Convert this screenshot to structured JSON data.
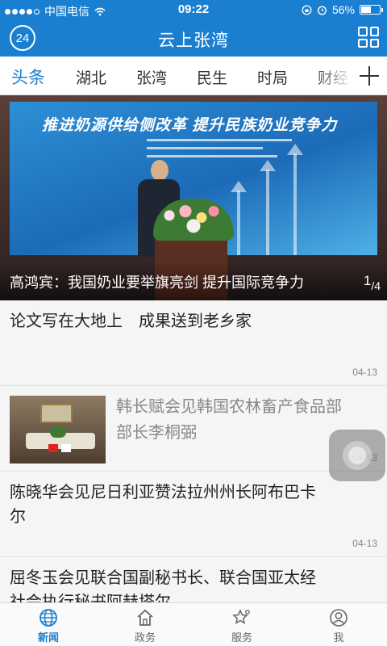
{
  "status_bar": {
    "carrier": "中国电信",
    "time": "09:22",
    "battery": "56%",
    "battery_level": 0.56
  },
  "app_bar": {
    "title": "云上张湾",
    "logo_text": "24"
  },
  "tabs": [
    "头条",
    "湖北",
    "张湾",
    "民生",
    "时局",
    "财经"
  ],
  "hero": {
    "banner": "推进奶源供给侧改革 提升民族奶业竞争力",
    "caption": "高鸿宾：我国奶业要举旗亮剑 提升国际竞争力",
    "pager_current": "1",
    "pager_total": "4"
  },
  "news": [
    {
      "title": "论文写在大地上　成果送到老乡家",
      "date": "04-13"
    },
    {
      "title_line1": "韩长赋会见韩国农林畜产食品部",
      "title_line2": "部长李桐弼",
      "date": "04-13"
    },
    {
      "title_line1": "陈晓华会见尼日利亚赞法拉州州长阿布巴卡",
      "title_line2": "尔",
      "date": "04-13"
    },
    {
      "title_line1": "屈冬玉会见联合国副秘书长、联合国亚太经",
      "title_line2": "社会执行秘书阿赫塔尔"
    }
  ],
  "tab_bar": [
    {
      "label": "新闻",
      "icon": "globe-icon"
    },
    {
      "label": "政务",
      "icon": "house-icon"
    },
    {
      "label": "服务",
      "icon": "star-icon"
    },
    {
      "label": "我",
      "icon": "person-icon"
    }
  ]
}
